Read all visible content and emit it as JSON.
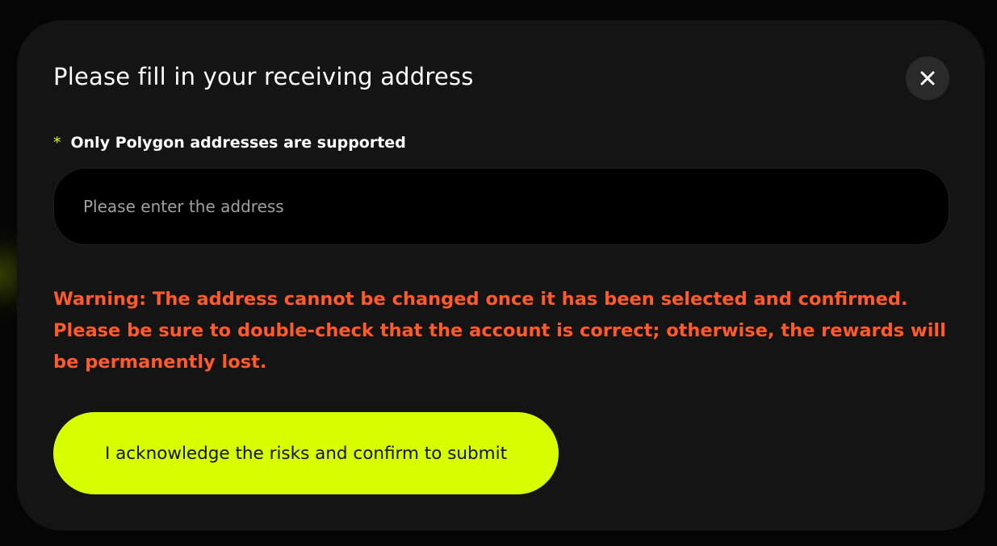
{
  "modal": {
    "title": "Please fill in your receiving address",
    "close_icon": "close-icon"
  },
  "address_field": {
    "required_mark": "*",
    "label": "Only Polygon addresses are supported",
    "placeholder": "Please enter the address",
    "value": ""
  },
  "warning": {
    "text": "Warning: The address cannot be changed once it has been selected and confirmed. Please be sure to double-check that the account is correct; otherwise, the rewards will be permanently lost."
  },
  "submit": {
    "label": "I acknowledge the risks and confirm to submit"
  },
  "colors": {
    "accent": "#d8ff00",
    "warning": "#ff5a2c",
    "modal_background": "#141414",
    "input_background": "#000000"
  }
}
